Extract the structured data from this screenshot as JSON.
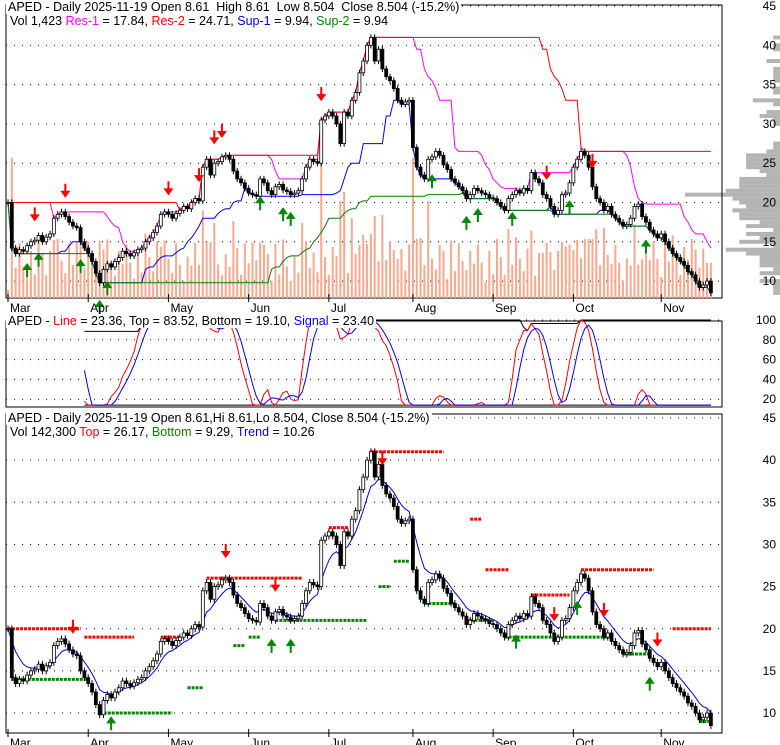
{
  "top_panel": {
    "title": "APED - Daily 2025-11-19 Open 8.61  High 8.61  Low 8.504  Close 8.504 (-15.2%)",
    "vol": "Vol 1,423 ",
    "res1_label": "Res-1",
    "res1_value": " = 17.84, ",
    "res2_label": "Res-2",
    "res2_value": " = 24.71, ",
    "sup1_label": "Sup-1",
    "sup1_value": " = 9.94, ",
    "sup2_label": "Sup-2",
    "sup2_value": " = 9.94"
  },
  "mid_panel": {
    "prefix": "APED - ",
    "line_label": "Line",
    "line_value": " = 23.36, Top = 83.52, Bottom = 19.10, ",
    "signal_label": "Signal",
    "signal_value": " = 23.40"
  },
  "low_panel": {
    "title": "APED - Daily 2025-11-19 Open 8.61,Hi 8.61,Lo 8.504, Close 8.504 (-15.2%)",
    "vol": "Vol 142,300 ",
    "top_label": "Top",
    "top_value": " = 26.17, ",
    "bottom_label": "Bottom",
    "bottom_value": " = 9.29, ",
    "trend_label": "Trend",
    "trend_value": " = 10.26"
  },
  "colors": {
    "res1": "#ff00ff",
    "res2": "#ff0000",
    "sup1": "#0000ff",
    "sup2": "#008000",
    "volume": "#f8a88c",
    "profile": "#b4b4b4"
  },
  "chart_data": {
    "type": "candlestick",
    "months": [
      "Mar",
      "Apr",
      "May",
      "Jun",
      "Jul",
      "Aug",
      "Sep",
      "Oct",
      "Nov"
    ],
    "month_start_index": [
      0,
      21,
      42,
      63,
      84,
      106,
      127,
      148,
      171
    ],
    "price_ticks": [
      45,
      40,
      35,
      30,
      25,
      20,
      15,
      10
    ],
    "osc_ticks": [
      100,
      80,
      60,
      40,
      20
    ],
    "price_range": [
      8,
      45
    ],
    "osc_range": [
      12,
      102
    ],
    "closes": [
      20.0,
      14.2,
      13.5,
      14.0,
      13.8,
      14.5,
      15.0,
      15.2,
      15.8,
      15.0,
      15.6,
      16.0,
      18.0,
      18.5,
      18.8,
      18.2,
      17.5,
      17.0,
      16.8,
      15.0,
      14.2,
      13.5,
      12.5,
      11.0,
      9.8,
      11.5,
      12.2,
      11.8,
      12.5,
      13.0,
      13.8,
      13.5,
      13.2,
      13.6,
      14.0,
      14.2,
      15.0,
      15.5,
      16.2,
      17.0,
      18.5,
      18.8,
      18.5,
      18.0,
      18.6,
      19.0,
      19.5,
      19.2,
      20.0,
      20.5,
      20.2,
      24.5,
      25.5,
      23.5,
      25.0,
      25.2,
      25.8,
      26.0,
      25.5,
      24.0,
      23.0,
      22.5,
      21.8,
      21.2,
      21.0,
      20.8,
      23.0,
      22.5,
      21.5,
      21.0,
      22.0,
      22.3,
      21.6,
      21.4,
      21.0,
      21.2,
      21.5,
      23.0,
      24.5,
      25.5,
      25.2,
      25.0,
      30.5,
      31.0,
      31.5,
      31.0,
      30.0,
      27.5,
      31.5,
      31.0,
      33.0,
      34.0,
      36.5,
      38.0,
      40.0,
      41.0,
      38.0,
      39.5,
      37.0,
      36.0,
      35.5,
      34.5,
      33.0,
      32.5,
      32.8,
      33.0,
      27.0,
      24.5,
      23.5,
      23.0,
      25.5,
      25.8,
      26.5,
      26.0,
      24.8,
      24.2,
      23.0,
      22.5,
      22.0,
      21.5,
      20.5,
      21.0,
      21.8,
      21.5,
      21.2,
      21.0,
      20.6,
      20.5,
      20.0,
      19.5,
      19.0,
      20.5,
      21.0,
      21.5,
      21.2,
      21.8,
      21.5,
      23.8,
      23.0,
      22.5,
      21.0,
      20.5,
      19.5,
      18.5,
      19.0,
      21.0,
      21.2,
      22.5,
      24.5,
      25.5,
      26.5,
      26.0,
      24.5,
      22.0,
      20.5,
      20.0,
      19.0,
      19.5,
      18.5,
      18.0,
      17.5,
      17.0,
      17.2,
      18.0,
      19.5,
      19.8,
      18.2,
      17.5,
      16.5,
      16.0,
      15.5,
      16.0,
      15.0,
      14.2,
      13.5,
      13.0,
      12.5,
      12.0,
      11.2,
      10.8,
      10.0,
      9.2,
      9.5,
      10.0,
      8.504
    ],
    "top_signals": {
      "sell": [
        7,
        15,
        42,
        50,
        54,
        56,
        82,
        141,
        153
      ],
      "buy": [
        5,
        8,
        19,
        24,
        26,
        66,
        72,
        74,
        111,
        120,
        123,
        132,
        147,
        167
      ]
    },
    "low_signals": {
      "sell": [
        17,
        57,
        70,
        98,
        143,
        156,
        170
      ],
      "buy": [
        27,
        69,
        74,
        133,
        149,
        168
      ]
    }
  }
}
